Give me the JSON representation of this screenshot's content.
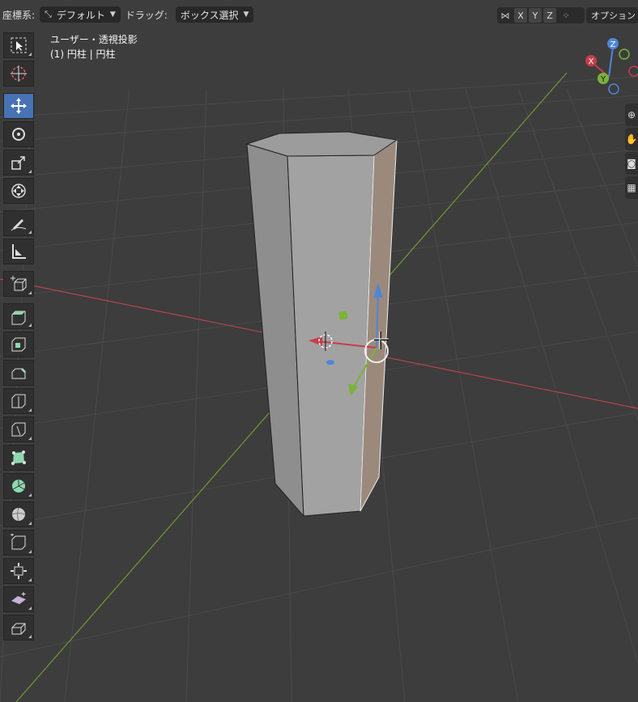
{
  "header": {
    "coord_label": "座標系:",
    "coord_value": "デフォルト",
    "drag_label": "ドラッグ:",
    "drag_value": "ボックス選択",
    "axes": [
      "X",
      "Y",
      "Z"
    ],
    "options_label": "オプション"
  },
  "viewport": {
    "view_name": "ユーザー・透視投影",
    "object_info": "(1) 円柱 | 円柱"
  },
  "gizmo": {
    "z": "Z",
    "x": "X",
    "y": "Y"
  },
  "colors": {
    "background": "#3d3d3d",
    "accent_active": "#4772b3",
    "x_axis": "#c83c4a",
    "y_axis": "#7bb23a",
    "z_axis": "#4f86d6"
  },
  "toolbar": [
    "select-box-icon",
    "cursor-icon",
    "move-icon",
    "rotate-icon",
    "scale-icon",
    "transform-icon",
    "annotate-icon",
    "measure-icon",
    "add-cube-icon",
    "extrude-region-icon",
    "inset-faces-icon",
    "bevel-icon",
    "loop-cut-icon",
    "knife-icon",
    "poly-build-icon",
    "spin-icon",
    "smooth-icon",
    "edge-slide-icon",
    "shrink-fatten-icon",
    "shear-icon",
    "rip-region-icon"
  ]
}
